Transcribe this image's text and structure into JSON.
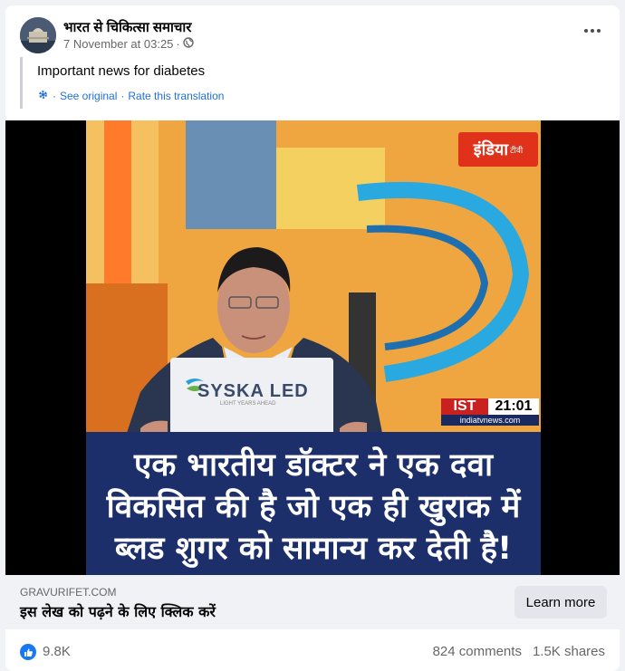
{
  "post": {
    "page_name": "भारत से चिकित्सा समाचार",
    "timestamp": "7 November at 03:25",
    "separator": "·",
    "audience_icon": "globe-icon",
    "text": "Important news for diabetes",
    "see_original": "See original",
    "rate_translation": "Rate this translation",
    "translate_dot": "·"
  },
  "video": {
    "channel_logo": "इंडिया",
    "channel_logo_sub": "टीवी",
    "time_zone": "IST",
    "time": "21:01",
    "site": "indiatvnews.com",
    "laptop_brand": "SYSKA LED",
    "laptop_tagline": "LIGHT YEARS AHEAD",
    "caption_lines": [
      "एक भारतीय डॉक्टर ने एक दवा",
      "विकसित की है जो एक ही खुराक में",
      "ब्लड शुगर को सामान्य कर देती है!"
    ]
  },
  "link": {
    "domain": "GRAVURIFET.COM",
    "title": "इस लेख को पढ़ने के लिए क्लिक करें",
    "button": "Learn more"
  },
  "footer": {
    "likes": "9.8K",
    "comments": "824 comments",
    "shares": "1.5K shares"
  },
  "colors": {
    "link_blue": "#216fdb",
    "fb_blue": "#1877f2",
    "caption_bg": "#1c2f6b",
    "logo_red": "#e0321a"
  }
}
